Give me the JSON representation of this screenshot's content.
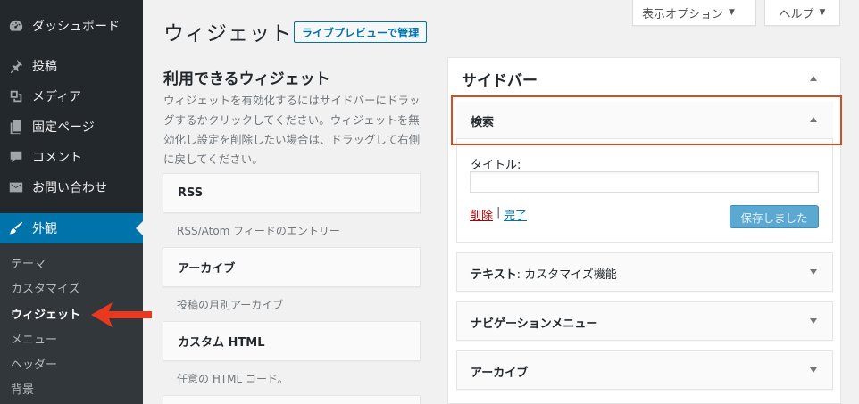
{
  "sidebar": {
    "items": [
      {
        "label": "ダッシュボード",
        "icon": "dashboard-icon"
      },
      {
        "label": "投稿",
        "icon": "pin-icon"
      },
      {
        "label": "メディア",
        "icon": "media-icon"
      },
      {
        "label": "固定ページ",
        "icon": "pages-icon"
      },
      {
        "label": "コメント",
        "icon": "comment-icon"
      },
      {
        "label": "お問い合わせ",
        "icon": "mail-icon"
      },
      {
        "label": "外観",
        "icon": "brush-icon"
      }
    ],
    "submenu": [
      "テーマ",
      "カスタマイズ",
      "ウィジェット",
      "メニュー",
      "ヘッダー",
      "背景"
    ]
  },
  "header": {
    "title": "ウィジェット",
    "live_preview": "ライブプレビューで管理",
    "screen_options": "表示オプション",
    "help": "ヘルプ"
  },
  "available": {
    "title": "利用できるウィジェット",
    "description": "ウィジェットを有効化するにはサイドバーにドラッグするかクリックしてください。ウィジェットを無効化し設定を削除したい場合は、ドラッグして右側に戻してください。",
    "widgets": [
      {
        "name": "RSS",
        "desc": "RSS/Atom フィードのエントリー"
      },
      {
        "name": "アーカイブ",
        "desc": "投稿の月別アーカイブ"
      },
      {
        "name": "カスタム HTML",
        "desc": "任意の HTML コード。"
      }
    ]
  },
  "sidebar_area": {
    "title": "サイドバー",
    "search_widget": {
      "title": "検索",
      "title_label": "タイトル:",
      "title_value": "",
      "delete": "削除",
      "separator": "|",
      "done": "完了",
      "saved": "保存しました"
    },
    "widgets": [
      {
        "title": "テキスト",
        "subtitle": ": カスタマイズ機能"
      },
      {
        "title": "ナビゲーションメニュー",
        "subtitle": ""
      },
      {
        "title": "アーカイブ",
        "subtitle": ""
      }
    ]
  },
  "colors": {
    "sidebar_bg": "#23282d",
    "active": "#0073aa",
    "highlight": "#d54e21",
    "delete": "#a00"
  }
}
